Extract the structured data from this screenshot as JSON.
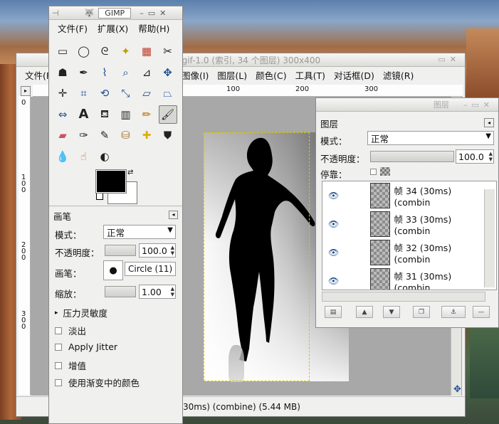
{
  "image_window": {
    "title": "tanz.gif-1.0 (索引, 34 个图层) 300x400",
    "menu": [
      "文件(F)",
      "图像(I)",
      "图层(L)",
      "颜色(C)",
      "工具(T)",
      "对话框(D)",
      "滤镜(R)"
    ],
    "ruler_top": [
      "100",
      "200",
      "300"
    ],
    "ruler_left": [
      "0",
      "1 0 0",
      "2 0 0",
      "3 0 0"
    ],
    "status": "30ms) (combine) (5.44 MB)"
  },
  "toolbox": {
    "title": "GIMP",
    "menu": [
      "文件(F)",
      "扩展(X)",
      "帮助(H)"
    ],
    "tools": [
      "rect-select-icon",
      "ellipse-select-icon",
      "lasso-icon",
      "fuzzy-select-icon",
      "color-select-icon",
      "scissors-icon",
      "foreground-select-icon",
      "paths-icon",
      "color-picker-icon",
      "zoom-icon",
      "measure-icon",
      "move-icon",
      "align-icon",
      "crop-icon",
      "rotate-icon",
      "scale-icon",
      "shear-icon",
      "perspective-icon",
      "flip-icon",
      "text-icon",
      "bucket-fill-icon",
      "blend-icon",
      "pencil-icon",
      "paintbrush-icon",
      "eraser-icon",
      "airbrush-icon",
      "ink-icon",
      "clone-icon",
      "heal-icon",
      "perspective-clone-icon",
      "blur-icon",
      "smudge-icon",
      "dodge-burn-icon"
    ],
    "fg_color": "#000000",
    "bg_color": "#ffffff"
  },
  "tool_options": {
    "title": "画笔",
    "mode_label": "模式：",
    "mode_value": "正常",
    "opacity_label": "不透明度：",
    "opacity_value": "100.0",
    "brush_label": "画笔：",
    "brush_value": "Circle (11)",
    "scale_label": "缩放：",
    "scale_value": "1.00",
    "pressure_label": "压力灵敏度",
    "fade_label": "淡出",
    "jitter_label": "Apply Jitter",
    "incremental_label": "增值",
    "gradient_label": "使用渐变中的颜色"
  },
  "layers_dock": {
    "window_title": "图层",
    "tab_title": "图层",
    "mode_label": "模式：",
    "mode_value": "正常",
    "opacity_label": "不透明度：",
    "opacity_value": "100.0",
    "lock_label": "停靠：",
    "layers": [
      {
        "name": "帧 34 (30ms) (combin"
      },
      {
        "name": "帧 33 (30ms) (combin"
      },
      {
        "name": "帧 32 (30ms) (combin"
      },
      {
        "name": "帧 31 (30ms) (combin"
      }
    ]
  }
}
